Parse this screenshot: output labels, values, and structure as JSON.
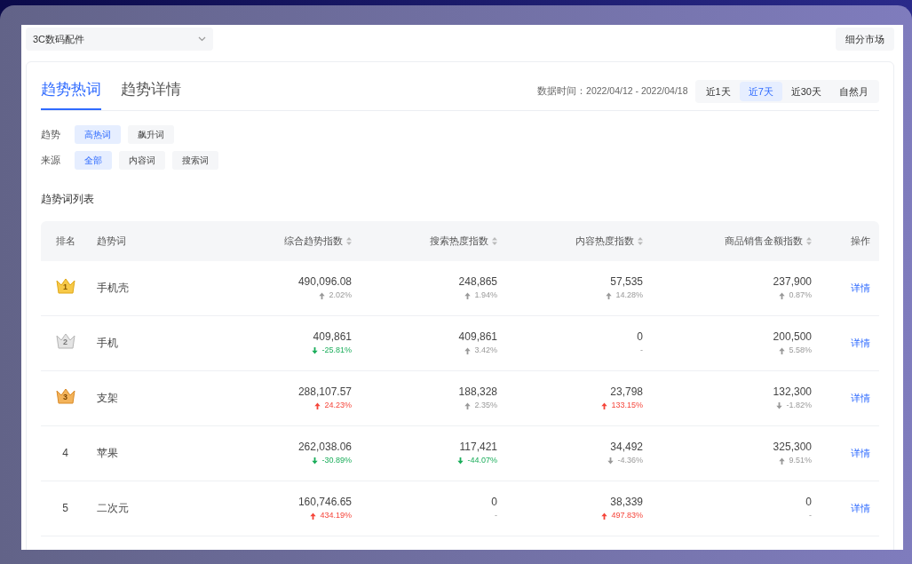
{
  "category_select": {
    "value": "3C数码配件"
  },
  "market_button": "细分市场",
  "tabs": [
    {
      "label": "趋势热词",
      "selected": true
    },
    {
      "label": "趋势详情",
      "selected": false
    }
  ],
  "date_range": "数据时间：2022/04/12 - 2022/04/18",
  "periods": [
    {
      "label": "近1天",
      "selected": false
    },
    {
      "label": "近7天",
      "selected": true
    },
    {
      "label": "近30天",
      "selected": false
    },
    {
      "label": "自然月",
      "selected": false
    }
  ],
  "filters": [
    {
      "label": "趋势",
      "options": [
        {
          "label": "高热词",
          "selected": true
        },
        {
          "label": "飙升词",
          "selected": false
        }
      ]
    },
    {
      "label": "来源",
      "options": [
        {
          "label": "全部",
          "selected": true
        },
        {
          "label": "内容词",
          "selected": false
        },
        {
          "label": "搜索词",
          "selected": false
        }
      ]
    }
  ],
  "section_title": "趋势词列表",
  "table": {
    "columns": [
      {
        "label": "排名",
        "sortable": false,
        "kind": "rank"
      },
      {
        "label": "趋势词",
        "sortable": false,
        "kind": "word"
      },
      {
        "label": "综合趋势指数",
        "sortable": true,
        "kind": "metric"
      },
      {
        "label": "搜索热度指数",
        "sortable": true,
        "kind": "metric"
      },
      {
        "label": "内容热度指数",
        "sortable": true,
        "kind": "metric"
      },
      {
        "label": "商品销售金额指数",
        "sortable": true,
        "kind": "metric"
      },
      {
        "label": "操作",
        "sortable": false,
        "kind": "action"
      }
    ],
    "rows": [
      {
        "rank": {
          "text": "1",
          "kind": "gold"
        },
        "word": "手机壳",
        "metrics": [
          {
            "value": "490,096.08",
            "change": "2.02%",
            "kind": "up",
            "color": "#999999"
          },
          {
            "value": "248,865",
            "change": "1.94%",
            "kind": "up",
            "color": "#999999"
          },
          {
            "value": "57,535",
            "change": "14.28%",
            "kind": "up",
            "color": "#999999"
          },
          {
            "value": "237,900",
            "change": "0.87%",
            "kind": "up",
            "color": "#999999"
          }
        ],
        "action": "详情"
      },
      {
        "rank": {
          "text": "2",
          "kind": "silver"
        },
        "word": "手机",
        "metrics": [
          {
            "value": "409,861",
            "change": "-25.81%",
            "kind": "down",
            "color": "#1aad5a"
          },
          {
            "value": "409,861",
            "change": "3.42%",
            "kind": "up",
            "color": "#999999"
          },
          {
            "value": "0",
            "change": "-",
            "kind": "flat"
          },
          {
            "value": "200,500",
            "change": "5.58%",
            "kind": "up",
            "color": "#999999"
          }
        ],
        "action": "详情"
      },
      {
        "rank": {
          "text": "3",
          "kind": "bronze"
        },
        "word": "支架",
        "metrics": [
          {
            "value": "288,107.57",
            "change": "24.23%",
            "kind": "up",
            "color": "#f5453a"
          },
          {
            "value": "188,328",
            "change": "2.35%",
            "kind": "up",
            "color": "#999999"
          },
          {
            "value": "23,798",
            "change": "133.15%",
            "kind": "up",
            "color": "#f5453a"
          },
          {
            "value": "132,300",
            "change": "-1.82%",
            "kind": "down",
            "color": "#999999"
          }
        ],
        "action": "详情"
      },
      {
        "rank": {
          "text": "4",
          "kind": "plain"
        },
        "word": "苹果",
        "metrics": [
          {
            "value": "262,038.06",
            "change": "-30.89%",
            "kind": "down",
            "color": "#1aad5a"
          },
          {
            "value": "117,421",
            "change": "-44.07%",
            "kind": "down",
            "color": "#1aad5a"
          },
          {
            "value": "34,492",
            "change": "-4.36%",
            "kind": "down",
            "color": "#999999"
          },
          {
            "value": "325,300",
            "change": "9.51%",
            "kind": "up",
            "color": "#999999"
          }
        ],
        "action": "详情"
      },
      {
        "rank": {
          "text": "5",
          "kind": "plain"
        },
        "word": "二次元",
        "metrics": [
          {
            "value": "160,746.65",
            "change": "434.19%",
            "kind": "up",
            "color": "#f5453a"
          },
          {
            "value": "0",
            "change": "-",
            "kind": "flat"
          },
          {
            "value": "38,339",
            "change": "497.83%",
            "kind": "up",
            "color": "#f5453a"
          },
          {
            "value": "0",
            "change": "-",
            "kind": "flat"
          }
        ],
        "action": "详情"
      }
    ]
  }
}
